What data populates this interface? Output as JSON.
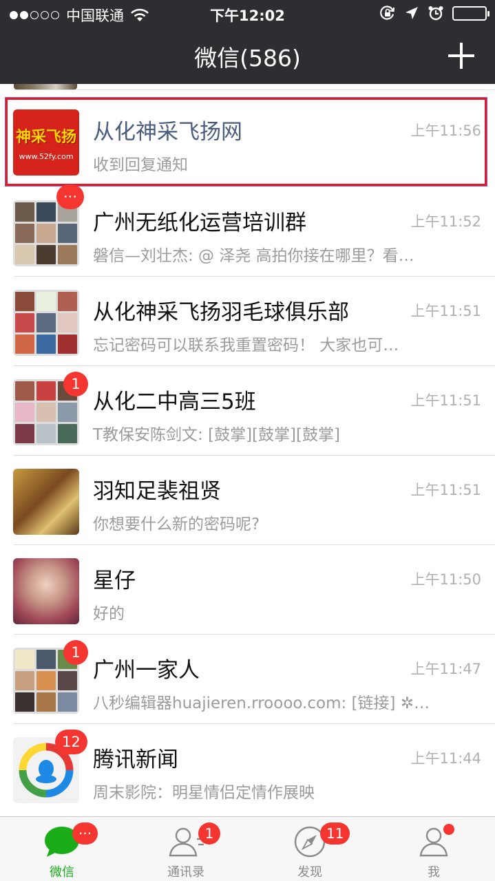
{
  "status_bar": {
    "carrier": "中国联通",
    "time": "下午12:02"
  },
  "nav": {
    "title": "微信(586)"
  },
  "chats": [
    {
      "name": "从化神采飞扬网",
      "preview": "收到回复通知",
      "time": "上午11:56",
      "badge": "",
      "avatar_text": "神采飞扬",
      "avatar_subtext": "www.52fy.com",
      "highlighted": true
    },
    {
      "name": "广州无纸化运营培训群",
      "preview": "磐信—刘壮杰: @  泽尧 高拍你接在哪里？看…",
      "time": "上午11:52",
      "badge": "···"
    },
    {
      "name": "从化神采飞扬羽毛球俱乐部",
      "preview": "忘记密码可以联系我重置密码！      大家也可…",
      "time": "上午11:51",
      "badge": ""
    },
    {
      "name": "从化二中高三5班",
      "preview": "T教保安陈剑文: [鼓掌][鼓掌][鼓掌]",
      "time": "上午11:51",
      "badge": "1"
    },
    {
      "name": "羽知足裴祖贤",
      "preview": "你想要什么新的密码呢?",
      "time": "上午11:51",
      "badge": ""
    },
    {
      "name": "星仔",
      "preview": "好的",
      "time": "上午11:50",
      "badge": ""
    },
    {
      "name": "广州一家人",
      "preview": "八秒编辑器huajieren.rroooo.com: [链接] ✲…",
      "time": "上午11:47",
      "badge": "1"
    },
    {
      "name": "腾讯新闻",
      "preview": "周末影院：明星情侣定情作展映",
      "time": "上午11:44",
      "badge": "12"
    }
  ],
  "tabs": [
    {
      "label": "微信",
      "badge": "···",
      "active": true
    },
    {
      "label": "通讯录",
      "badge": "1"
    },
    {
      "label": "发现",
      "badge": "11"
    },
    {
      "label": "我",
      "badge": ""
    }
  ],
  "colors": {
    "nav_bg": "#2e2e32",
    "badge_red": "#f43530",
    "active_green": "#1aad19",
    "highlight_border": "#e0192a"
  }
}
